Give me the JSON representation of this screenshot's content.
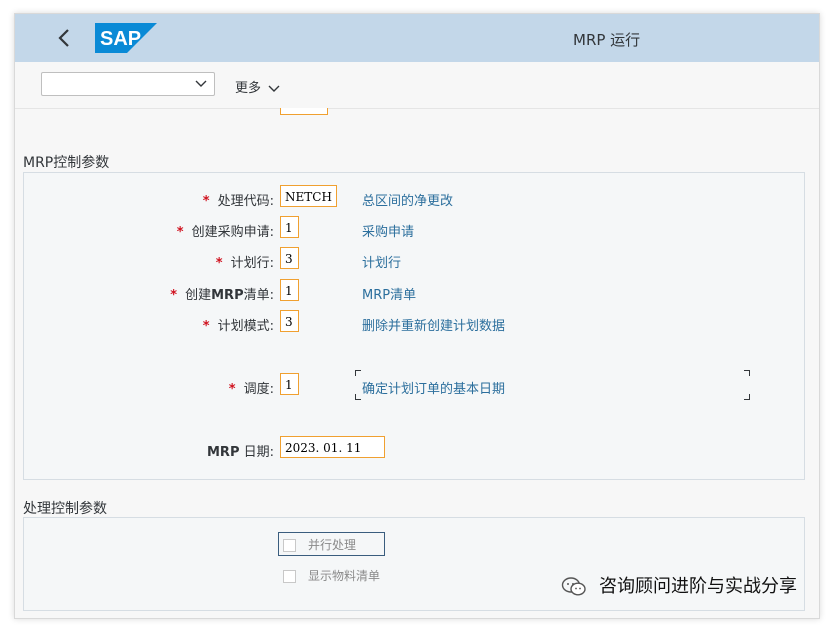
{
  "header": {
    "app_title": "MRP 运行",
    "logo_text": "SAP",
    "back_icon": "chevron-left-icon"
  },
  "toolbar": {
    "variant_value": "",
    "more_label": "更多"
  },
  "mrp_control": {
    "title": "MRP控制参数",
    "fields": {
      "processing_code": {
        "label": "处理代码:",
        "value": "NETCH",
        "desc": "总区间的净更改"
      },
      "create_pr": {
        "label": "创建采购申请:",
        "value": "1",
        "desc": "采购申请"
      },
      "schedule_lines": {
        "label": "计划行:",
        "value": "3",
        "desc": "计划行"
      },
      "create_mrp_list": {
        "label_prefix": "创建",
        "label_bold": "MRP",
        "label_suffix": "清单:",
        "value": "1",
        "desc": "MRP清单"
      },
      "planning_mode": {
        "label": "计划模式:",
        "value": "3",
        "desc": "删除并重新创建计划数据"
      },
      "scheduling": {
        "label": "调度:",
        "value": "1",
        "desc": "确定计划订单的基本日期"
      },
      "mrp_date": {
        "label_bold": "MRP",
        "label_suffix": " 日期:",
        "value": "2023. 01. 11"
      }
    }
  },
  "process_control": {
    "title": "处理控制参数",
    "parallel": {
      "label": "并行处理",
      "checked": false
    },
    "show_material_list": {
      "label": "显示物料清单",
      "checked": false
    }
  },
  "watermark": {
    "text": "咨询顾问进阶与实战分享"
  },
  "colors": {
    "shell": "#c3d7e9",
    "required": "#d0121f",
    "link": "#2c6f9d",
    "field_border": "#f0a030"
  }
}
